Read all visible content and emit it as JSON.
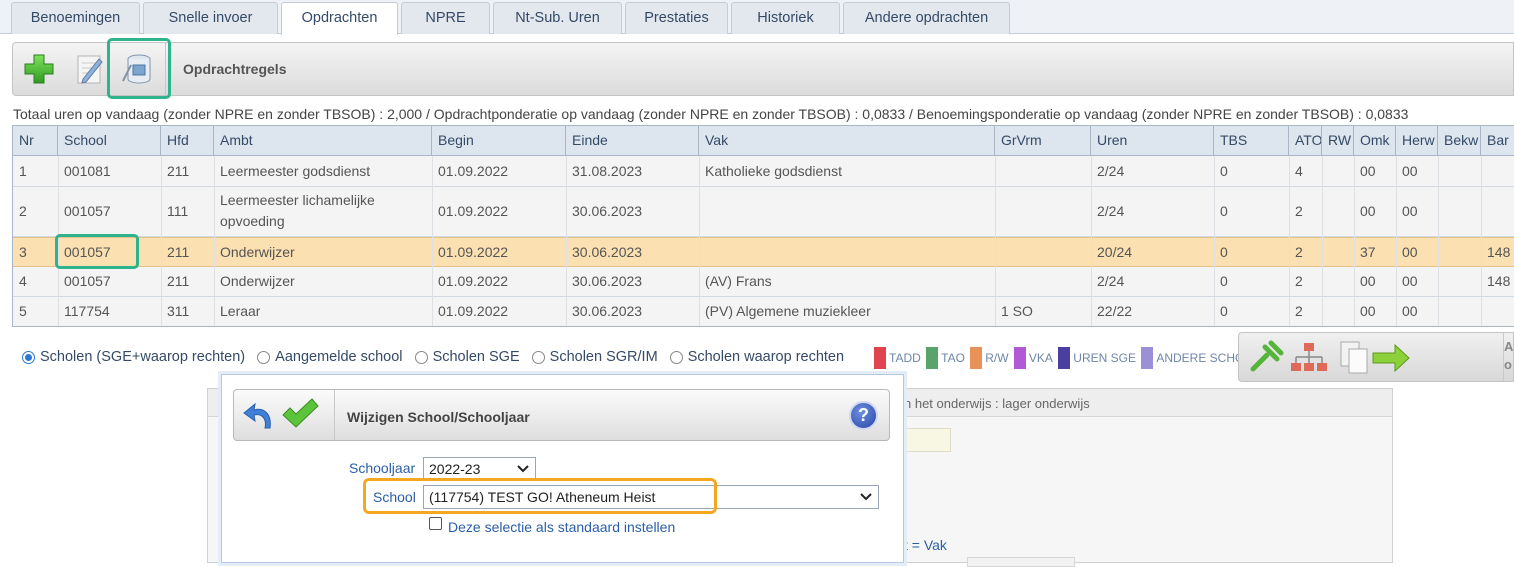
{
  "tabs": [
    {
      "label": "Benoemingen"
    },
    {
      "label": "Snelle invoer"
    },
    {
      "label": "Opdrachten"
    },
    {
      "label": "NPRE"
    },
    {
      "label": "Nt-Sub. Uren"
    },
    {
      "label": "Prestaties"
    },
    {
      "label": "Historiek"
    },
    {
      "label": "Andere opdrachten"
    }
  ],
  "toolbar": {
    "title": "Opdrachtregels",
    "buttons": [
      {
        "icon": "add-plus-icon"
      },
      {
        "icon": "edit-pencil-icon"
      },
      {
        "icon": "change-school-icon"
      }
    ]
  },
  "summary": "Totaal uren op vandaag (zonder NPRE en zonder TBSOB) : 2,000 / Opdrachtponderatie op vandaag (zonder NPRE en zonder TBSOB) : 0,0833 / Benoemingsponderatie op vandaag (zonder NPRE en zonder TBSOB) : 0,0833",
  "table": {
    "columns": [
      "Nr",
      "School",
      "Hfd",
      "Ambt",
      "Begin",
      "Einde",
      "Vak",
      "GrVrm",
      "Uren",
      "TBS",
      "ATO",
      "RW",
      "Omk",
      "Herw",
      "Bekw",
      "Bar"
    ],
    "rows": [
      {
        "nr": "1",
        "school": "001081",
        "hfd": "211",
        "ambt": [
          "Leermeester godsdienst"
        ],
        "begin": "01.09.2022",
        "einde": "31.08.2023",
        "vak": "Katholieke godsdienst",
        "grvrm": "",
        "uren": "2/24",
        "tbs": "0",
        "ato": "4",
        "rw": "",
        "omk": "00",
        "herw": "00",
        "bekw": "",
        "bar": ""
      },
      {
        "nr": "2",
        "school": "001057",
        "hfd": "111",
        "ambt": [
          "Leermeester lichamelijke",
          "opvoeding"
        ],
        "begin": "01.09.2022",
        "einde": "30.06.2023",
        "vak": "",
        "grvrm": "",
        "uren": "2/24",
        "tbs": "0",
        "ato": "2",
        "rw": "",
        "omk": "00",
        "herw": "00",
        "bekw": "",
        "bar": ""
      },
      {
        "nr": "3",
        "school": "001057",
        "hfd": "211",
        "ambt": [
          "Onderwijzer"
        ],
        "begin": "01.09.2022",
        "einde": "30.06.2023",
        "vak": "",
        "grvrm": "",
        "uren": "20/24",
        "tbs": "0",
        "ato": "2",
        "rw": "",
        "omk": "37",
        "herw": "00",
        "bekw": "",
        "bar": "148",
        "selected": true
      },
      {
        "nr": "4",
        "school": "001057",
        "hfd": "211",
        "ambt": [
          "Onderwijzer"
        ],
        "begin": "01.09.2022",
        "einde": "30.06.2023",
        "vak": "(AV) Frans",
        "grvrm": "",
        "uren": "2/24",
        "tbs": "0",
        "ato": "2",
        "rw": "",
        "omk": "00",
        "herw": "00",
        "bekw": "",
        "bar": "148"
      },
      {
        "nr": "5",
        "school": "117754",
        "hfd": "311",
        "ambt": [
          "Leraar"
        ],
        "begin": "01.09.2022",
        "einde": "30.06.2023",
        "vak": "(PV) Algemene muziekleer",
        "grvrm": "1 SO",
        "uren": "22/22",
        "tbs": "0",
        "ato": "2",
        "rw": "",
        "omk": "00",
        "herw": "00",
        "bekw": "",
        "bar": ""
      }
    ]
  },
  "radios": [
    {
      "label": "Scholen (SGE+waarop rechten)",
      "checked": true
    },
    {
      "label": "Aangemelde school",
      "checked": false
    },
    {
      "label": "Scholen SGE",
      "checked": false
    },
    {
      "label": "Scholen SGR/IM",
      "checked": false
    },
    {
      "label": "Scholen waarop rechten",
      "checked": false
    }
  ],
  "legend": [
    {
      "label": "TADD",
      "color": "#e0454f"
    },
    {
      "label": "TAO",
      "color": "#5aa36a"
    },
    {
      "label": "R/W",
      "color": "#e8925a"
    },
    {
      "label": "VKA",
      "color": "#b25ad6"
    },
    {
      "label": "UREN SGE",
      "color": "#4a3fa0"
    },
    {
      "label": "ANDERE SCHOOL",
      "color": "#9b8fd8"
    }
  ],
  "actions_partial_text": [
    "A",
    "o"
  ],
  "background": {
    "panel_header_fragment": "n het onderwijs : lager onderwijs",
    "fragment": "t = Vak"
  },
  "dialog": {
    "title": "Wijzigen School/Schooljaar",
    "schooljaar_label": "Schooljaar",
    "schooljaar_value": "2022-23",
    "school_label": "School",
    "school_value": "(117754) TEST GO! Atheneum Heist",
    "checkbox_label": "Deze selectie als standaard instellen",
    "checkbox_checked": false,
    "help_glyph": "?"
  }
}
